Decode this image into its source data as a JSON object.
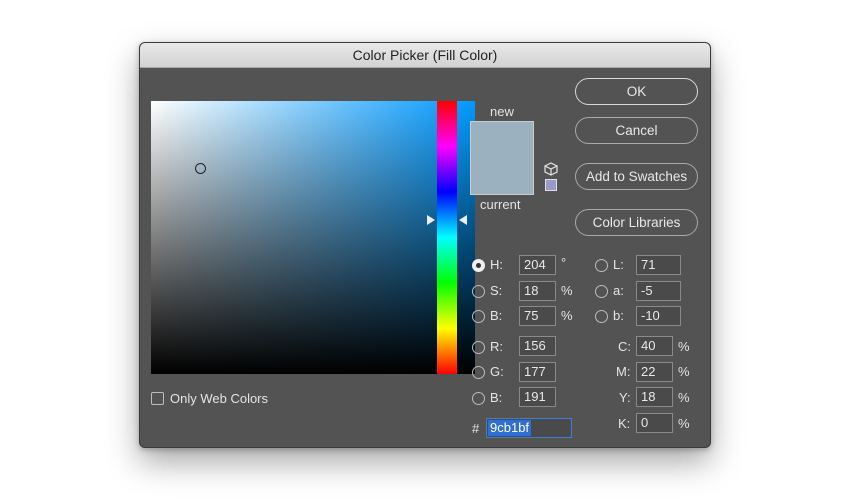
{
  "window": {
    "title": "Color Picker (Fill Color)"
  },
  "labels": {
    "new": "new",
    "current": "current"
  },
  "colors": {
    "new": "#9cb1bf",
    "current": "#9cb1bf",
    "web_safe": "#9999cc",
    "field_hue": "#0099ff"
  },
  "buttons": {
    "ok": "OK",
    "cancel": "Cancel",
    "add_to_swatches": "Add to Swatches",
    "color_libraries": "Color Libraries"
  },
  "hsb": {
    "h": {
      "label": "H:",
      "value": "204",
      "unit": "°"
    },
    "s": {
      "label": "S:",
      "value": "18",
      "unit": "%"
    },
    "b": {
      "label": "B:",
      "value": "75",
      "unit": "%"
    }
  },
  "rgb": {
    "r": {
      "label": "R:",
      "value": "156"
    },
    "g": {
      "label": "G:",
      "value": "177"
    },
    "b": {
      "label": "B:",
      "value": "191"
    }
  },
  "lab": {
    "l": {
      "label": "L:",
      "value": "71"
    },
    "a": {
      "label": "a:",
      "value": "-5"
    },
    "b": {
      "label": "b:",
      "value": "-10"
    }
  },
  "cmyk": {
    "c": {
      "label": "C:",
      "value": "40",
      "unit": "%"
    },
    "m": {
      "label": "M:",
      "value": "22",
      "unit": "%"
    },
    "y": {
      "label": "Y:",
      "value": "18",
      "unit": "%"
    },
    "k": {
      "label": "K:",
      "value": "0",
      "unit": "%"
    }
  },
  "hex": {
    "label": "#",
    "value": "9cb1bf"
  },
  "options": {
    "only_web_colors": "Only Web Colors"
  },
  "icons": {
    "cube": "cube-icon",
    "radio": "radio-button"
  }
}
